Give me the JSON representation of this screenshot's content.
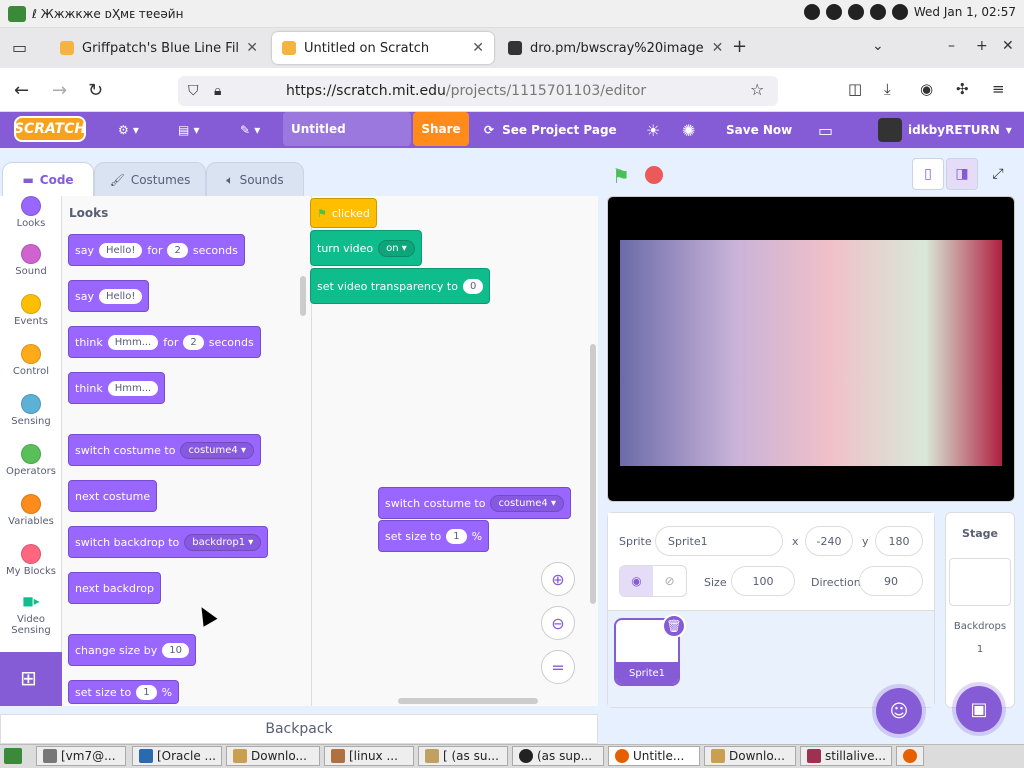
{
  "system_bar": {
    "left_text": "ℓ Жжжкже  ᴅҲмᴇ  ᴛɐeǝйн",
    "clock": "Wed Jan 1, 02:57"
  },
  "browser": {
    "tabs": [
      {
        "label": "Griffpatch's Blue Line Filter",
        "active": false
      },
      {
        "label": "Untitled on Scratch",
        "active": true
      },
      {
        "label": "dro.pm/bwscray%20image",
        "active": false
      }
    ],
    "new_tab": "+",
    "url_host": "https://scratch.mit.edu",
    "url_path": "/projects/1115701103/editor"
  },
  "scratch_menu": {
    "logo": "SCRATCH",
    "project_title": "Untitled",
    "share": "Share",
    "see_project": "See Project Page",
    "save_now": "Save Now",
    "username": "idkbyRETURN"
  },
  "editor_tabs": {
    "code": "Code",
    "costumes": "Costumes",
    "sounds": "Sounds"
  },
  "categories": [
    {
      "label": "Looks",
      "color": "#9966ff"
    },
    {
      "label": "Sound",
      "color": "#cf63cf"
    },
    {
      "label": "Events",
      "color": "#ffbf00"
    },
    {
      "label": "Control",
      "color": "#ffab19"
    },
    {
      "label": "Sensing",
      "color": "#5cb1d6"
    },
    {
      "label": "Operators",
      "color": "#59c059"
    },
    {
      "label": "Variables",
      "color": "#ff8c1a"
    },
    {
      "label": "My Blocks",
      "color": "#ff6680"
    },
    {
      "label": "Video Sensing",
      "color": "#0fbd8c"
    }
  ],
  "palette": {
    "title": "Looks",
    "say_for": {
      "say": "say",
      "msg": "Hello!",
      "for": "for",
      "secs": "2",
      "seconds": "seconds"
    },
    "say": {
      "say": "say",
      "msg": "Hello!"
    },
    "think_for": {
      "think": "think",
      "msg": "Hmm...",
      "for": "for",
      "secs": "2",
      "seconds": "seconds"
    },
    "think": {
      "think": "think",
      "msg": "Hmm..."
    },
    "switch_costume": {
      "label": "switch costume to",
      "value": "costume4"
    },
    "next_costume": "next costume",
    "switch_backdrop": {
      "label": "switch backdrop to",
      "value": "backdrop1"
    },
    "next_backdrop": "next backdrop",
    "change_size": {
      "label": "change size by",
      "value": "10"
    },
    "set_size": {
      "label": "set size to",
      "value": "1",
      "unit": "%"
    }
  },
  "workspace": {
    "hat": "clicked",
    "turn_video": {
      "label": "turn video",
      "value": "on"
    },
    "transparency": {
      "label": "set video transparency to",
      "value": "0"
    },
    "switch_costume": {
      "label": "switch costume to",
      "value": "costume4"
    },
    "set_size": {
      "label": "set size to",
      "value": "1",
      "unit": "%"
    }
  },
  "backpack": "Backpack",
  "sprite_info": {
    "sprite_label": "Sprite",
    "sprite_name": "Sprite1",
    "x_label": "x",
    "x": "-240",
    "y_label": "y",
    "y": "180",
    "size_label": "Size",
    "size": "100",
    "direction_label": "Direction",
    "direction": "90"
  },
  "sprite_list": [
    {
      "name": "Sprite1"
    }
  ],
  "stage_pane": {
    "title": "Stage",
    "backdrops_label": "Backdrops",
    "backdrops_count": "1"
  },
  "taskbar": [
    {
      "label": "[vm7@..."
    },
    {
      "label": "[Oracle ..."
    },
    {
      "label": "Downlo..."
    },
    {
      "label": "[linux ..."
    },
    {
      "label": "[ (as su..."
    },
    {
      "label": "(as sup..."
    },
    {
      "label": "Untitle..."
    },
    {
      "label": "Downlo..."
    },
    {
      "label": "stillalive..."
    }
  ],
  "colors": {
    "scratch_purple": "#855cd6",
    "looks": "#9966ff",
    "video": "#0fbd8c",
    "share": "#ff8c1a"
  }
}
